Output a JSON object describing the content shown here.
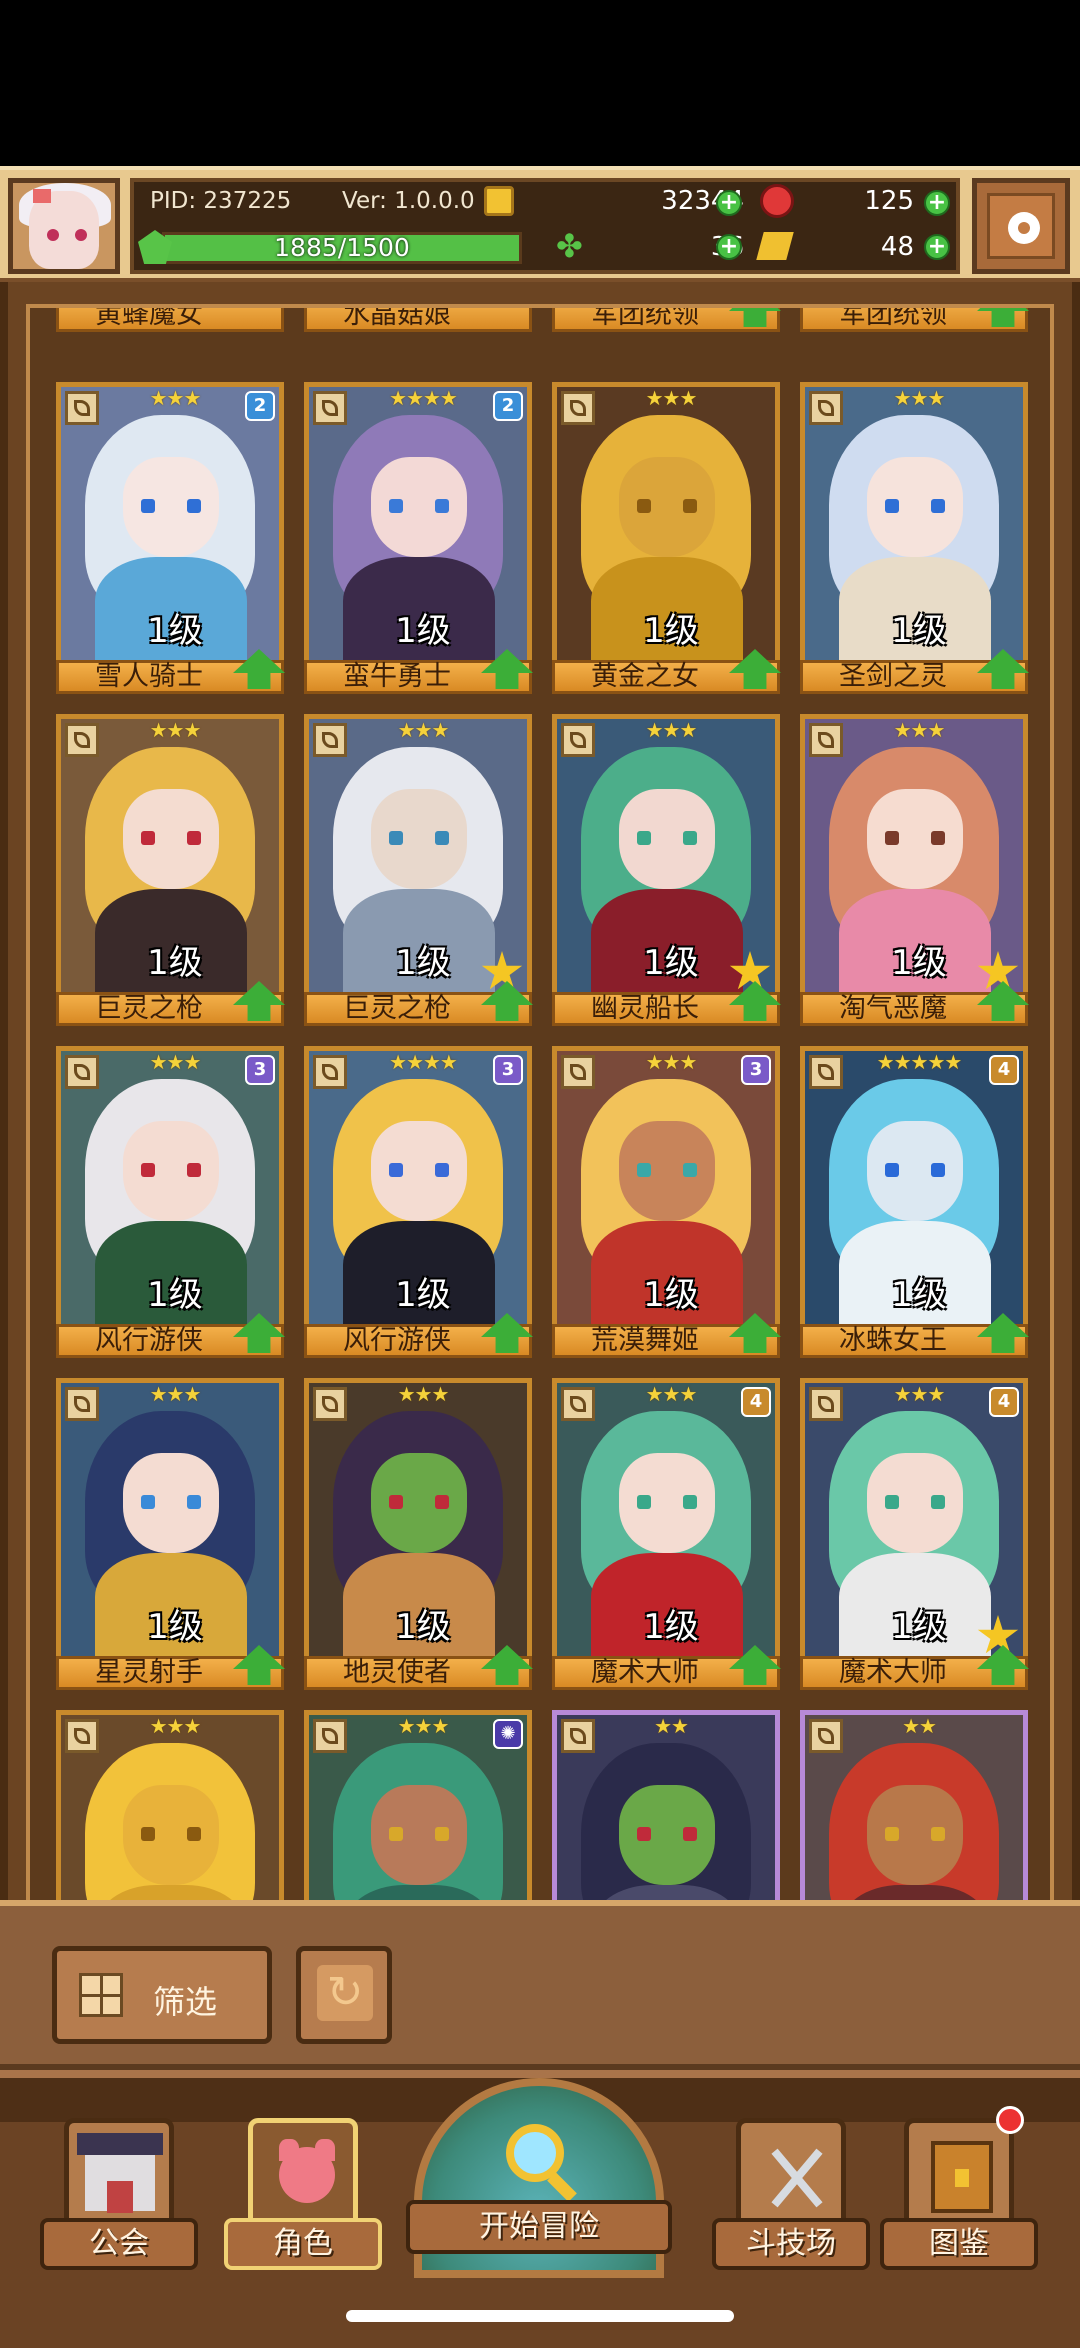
{
  "header": {
    "pid": "PID: 237225",
    "version": "Ver: 1.0.0.0",
    "gold": "32344",
    "ruby": "125",
    "xp_text": "1885/1500",
    "xp_fraction": 1.0,
    "clover": "36",
    "ticket": "48"
  },
  "top_row": [
    {
      "name": "黄蜂魔女",
      "up": false
    },
    {
      "name": "水晶菇娘",
      "up": false
    },
    {
      "name": "军团统领",
      "up": true
    },
    {
      "name": "军团统领",
      "up": true
    }
  ],
  "cards": [
    {
      "name": "雪人骑士",
      "level": "1级",
      "stars": "★★★",
      "badge": "2",
      "badge_color": "#3a8fd8",
      "up": true,
      "rank_star": false,
      "frame": "gold",
      "bg": "#6b7aa0",
      "hair": "#dfe8f2",
      "skin": "#f6e6e2",
      "eye": "#2f6fd6",
      "body": "#5aa8d8"
    },
    {
      "name": "蛮牛勇士",
      "level": "1级",
      "stars": "★★★★",
      "badge": "2",
      "badge_color": "#3a8fd8",
      "up": true,
      "rank_star": false,
      "frame": "gold",
      "bg": "#5a6a8a",
      "hair": "#8f7ab8",
      "skin": "#f3d9d6",
      "eye": "#3a7ad8",
      "body": "#3b2a4a"
    },
    {
      "name": "黄金之女",
      "level": "1级",
      "stars": "★★★",
      "badge": "",
      "badge_color": "",
      "up": true,
      "rank_star": false,
      "frame": "gold",
      "bg": "#5a3a22",
      "hair": "#e6b23a",
      "skin": "#dba53a",
      "eye": "#8a5a10",
      "body": "#c8921c"
    },
    {
      "name": "圣剑之灵",
      "level": "1级",
      "stars": "★★★",
      "badge": "",
      "badge_color": "",
      "up": true,
      "rank_star": false,
      "frame": "gold",
      "bg": "#4a6a8a",
      "hair": "#cfdcf0",
      "skin": "#f6e3dc",
      "eye": "#2f6fd6",
      "body": "#e8dcc8"
    },
    {
      "name": "巨灵之枪",
      "level": "1级",
      "stars": "★★★",
      "badge": "",
      "badge_color": "",
      "up": true,
      "rank_star": false,
      "frame": "gold",
      "bg": "#7a5a3a",
      "hair": "#e8b84a",
      "skin": "#f4dcd0",
      "eye": "#c02a3a",
      "body": "#3a2a2a"
    },
    {
      "name": "巨灵之枪",
      "level": "1级",
      "stars": "★★★",
      "badge": "",
      "badge_color": "",
      "up": true,
      "rank_star": true,
      "frame": "gold",
      "bg": "#5a6a88",
      "hair": "#e6e8ee",
      "skin": "#e8d8cc",
      "eye": "#3a8ab8",
      "body": "#8a9ab0"
    },
    {
      "name": "幽灵船长",
      "level": "1级",
      "stars": "★★★",
      "badge": "",
      "badge_color": "",
      "up": true,
      "rank_star": true,
      "frame": "gold",
      "bg": "#3a5a78",
      "hair": "#4cae8a",
      "skin": "#f2d8d0",
      "eye": "#3aa88a",
      "body": "#8a1e2a"
    },
    {
      "name": "淘气恶魔",
      "level": "1级",
      "stars": "★★★",
      "badge": "",
      "badge_color": "",
      "up": true,
      "rank_star": true,
      "frame": "gold",
      "bg": "#6a5a88",
      "hair": "#d88a6a",
      "skin": "#f6dcd0",
      "eye": "#7a3a2a",
      "body": "#e88aa8"
    },
    {
      "name": "风行游侠",
      "level": "1级",
      "stars": "★★★",
      "badge": "3",
      "badge_color": "#7a5ac8",
      "up": true,
      "rank_star": false,
      "frame": "gold",
      "bg": "#4a6a68",
      "hair": "#e8e6ea",
      "skin": "#f4dcd2",
      "eye": "#c02a3a",
      "body": "#2a5a3a"
    },
    {
      "name": "风行游侠",
      "level": "1级",
      "stars": "★★★★",
      "badge": "3",
      "badge_color": "#7a5ac8",
      "up": true,
      "rank_star": false,
      "frame": "gold",
      "bg": "#4a6a8a",
      "hair": "#f0c24a",
      "skin": "#f4dcd2",
      "eye": "#3a6ad8",
      "body": "#1e1e2a"
    },
    {
      "name": "荒漠舞姬",
      "level": "1级",
      "stars": "★★★",
      "badge": "3",
      "badge_color": "#7a5ac8",
      "up": true,
      "rank_star": false,
      "frame": "gold",
      "bg": "#7a4a3a",
      "hair": "#f2c25a",
      "skin": "#c8845a",
      "eye": "#3aa8a8",
      "body": "#c0342a"
    },
    {
      "name": "冰蛛女王",
      "level": "1级",
      "stars": "★★★★★",
      "badge": "4",
      "badge_color": "#c88a2c",
      "up": true,
      "rank_star": false,
      "frame": "gold",
      "bg": "#2a4a6a",
      "hair": "#6acae8",
      "skin": "#dce8f2",
      "eye": "#2a6ad8",
      "body": "#eaf2f6"
    },
    {
      "name": "星灵射手",
      "level": "1级",
      "stars": "★★★",
      "badge": "",
      "badge_color": "",
      "up": true,
      "rank_star": false,
      "frame": "gold",
      "bg": "#3a5a7a",
      "hair": "#2a3a6a",
      "skin": "#f4dcd2",
      "eye": "#3a8ad8",
      "body": "#d8a83a"
    },
    {
      "name": "地灵使者",
      "level": "1级",
      "stars": "★★★",
      "badge": "",
      "badge_color": "",
      "up": true,
      "rank_star": false,
      "frame": "gold",
      "bg": "#4a3a2a",
      "hair": "#3a2a4a",
      "skin": "#6aa848",
      "eye": "#c02a3a",
      "body": "#c88a4a"
    },
    {
      "name": "魔术大师",
      "level": "1级",
      "stars": "★★★",
      "badge": "4",
      "badge_color": "#c88a2c",
      "up": true,
      "rank_star": false,
      "frame": "gold",
      "bg": "#3a5a5a",
      "hair": "#5ab89a",
      "skin": "#f4dcd2",
      "eye": "#3aa88a",
      "body": "#c0242a"
    },
    {
      "name": "魔术大师",
      "level": "1级",
      "stars": "★★★",
      "badge": "4",
      "badge_color": "#c88a2c",
      "up": true,
      "rank_star": true,
      "frame": "gold",
      "bg": "#3a4a6a",
      "hair": "#6ac8a8",
      "skin": "#f4dcd2",
      "eye": "#3aa88a",
      "body": "#eaeaea"
    },
    {
      "name": "",
      "level": "",
      "stars": "★★★",
      "badge": "",
      "badge_color": "",
      "up": false,
      "rank_star": false,
      "frame": "gold",
      "bg": "#6a4a2a",
      "hair": "#f2c23a",
      "skin": "#e8b23a",
      "eye": "#8a5a10",
      "body": "#d8a22a"
    },
    {
      "name": "",
      "level": "",
      "stars": "★★★",
      "badge": "✺",
      "badge_color": "#4a3aa8",
      "up": false,
      "rank_star": false,
      "frame": "gold",
      "bg": "#3a5a4a",
      "hair": "#3a9a7a",
      "skin": "#b87a5a",
      "eye": "#d8a82a",
      "body": "#2a6a5a"
    },
    {
      "name": "",
      "level": "",
      "stars": "★★",
      "badge": "",
      "badge_color": "",
      "up": false,
      "rank_star": false,
      "frame": "purple",
      "bg": "#3a3a5a",
      "hair": "#2a2a4a",
      "skin": "#6aa848",
      "eye": "#c02a3a",
      "body": "#4a4a6a"
    },
    {
      "name": "",
      "level": "",
      "stars": "★★",
      "badge": "",
      "badge_color": "",
      "up": false,
      "rank_star": false,
      "frame": "purple",
      "bg": "#5a4a4a",
      "hair": "#c83a2a",
      "skin": "#b8784a",
      "eye": "#d8a82a",
      "body": "#6a2a2a"
    }
  ],
  "filter": {
    "label": "筛选"
  },
  "nav": {
    "guild": "公会",
    "characters": "角色",
    "adventure": "开始冒险",
    "arena": "斗技场",
    "codex": "图鉴"
  }
}
